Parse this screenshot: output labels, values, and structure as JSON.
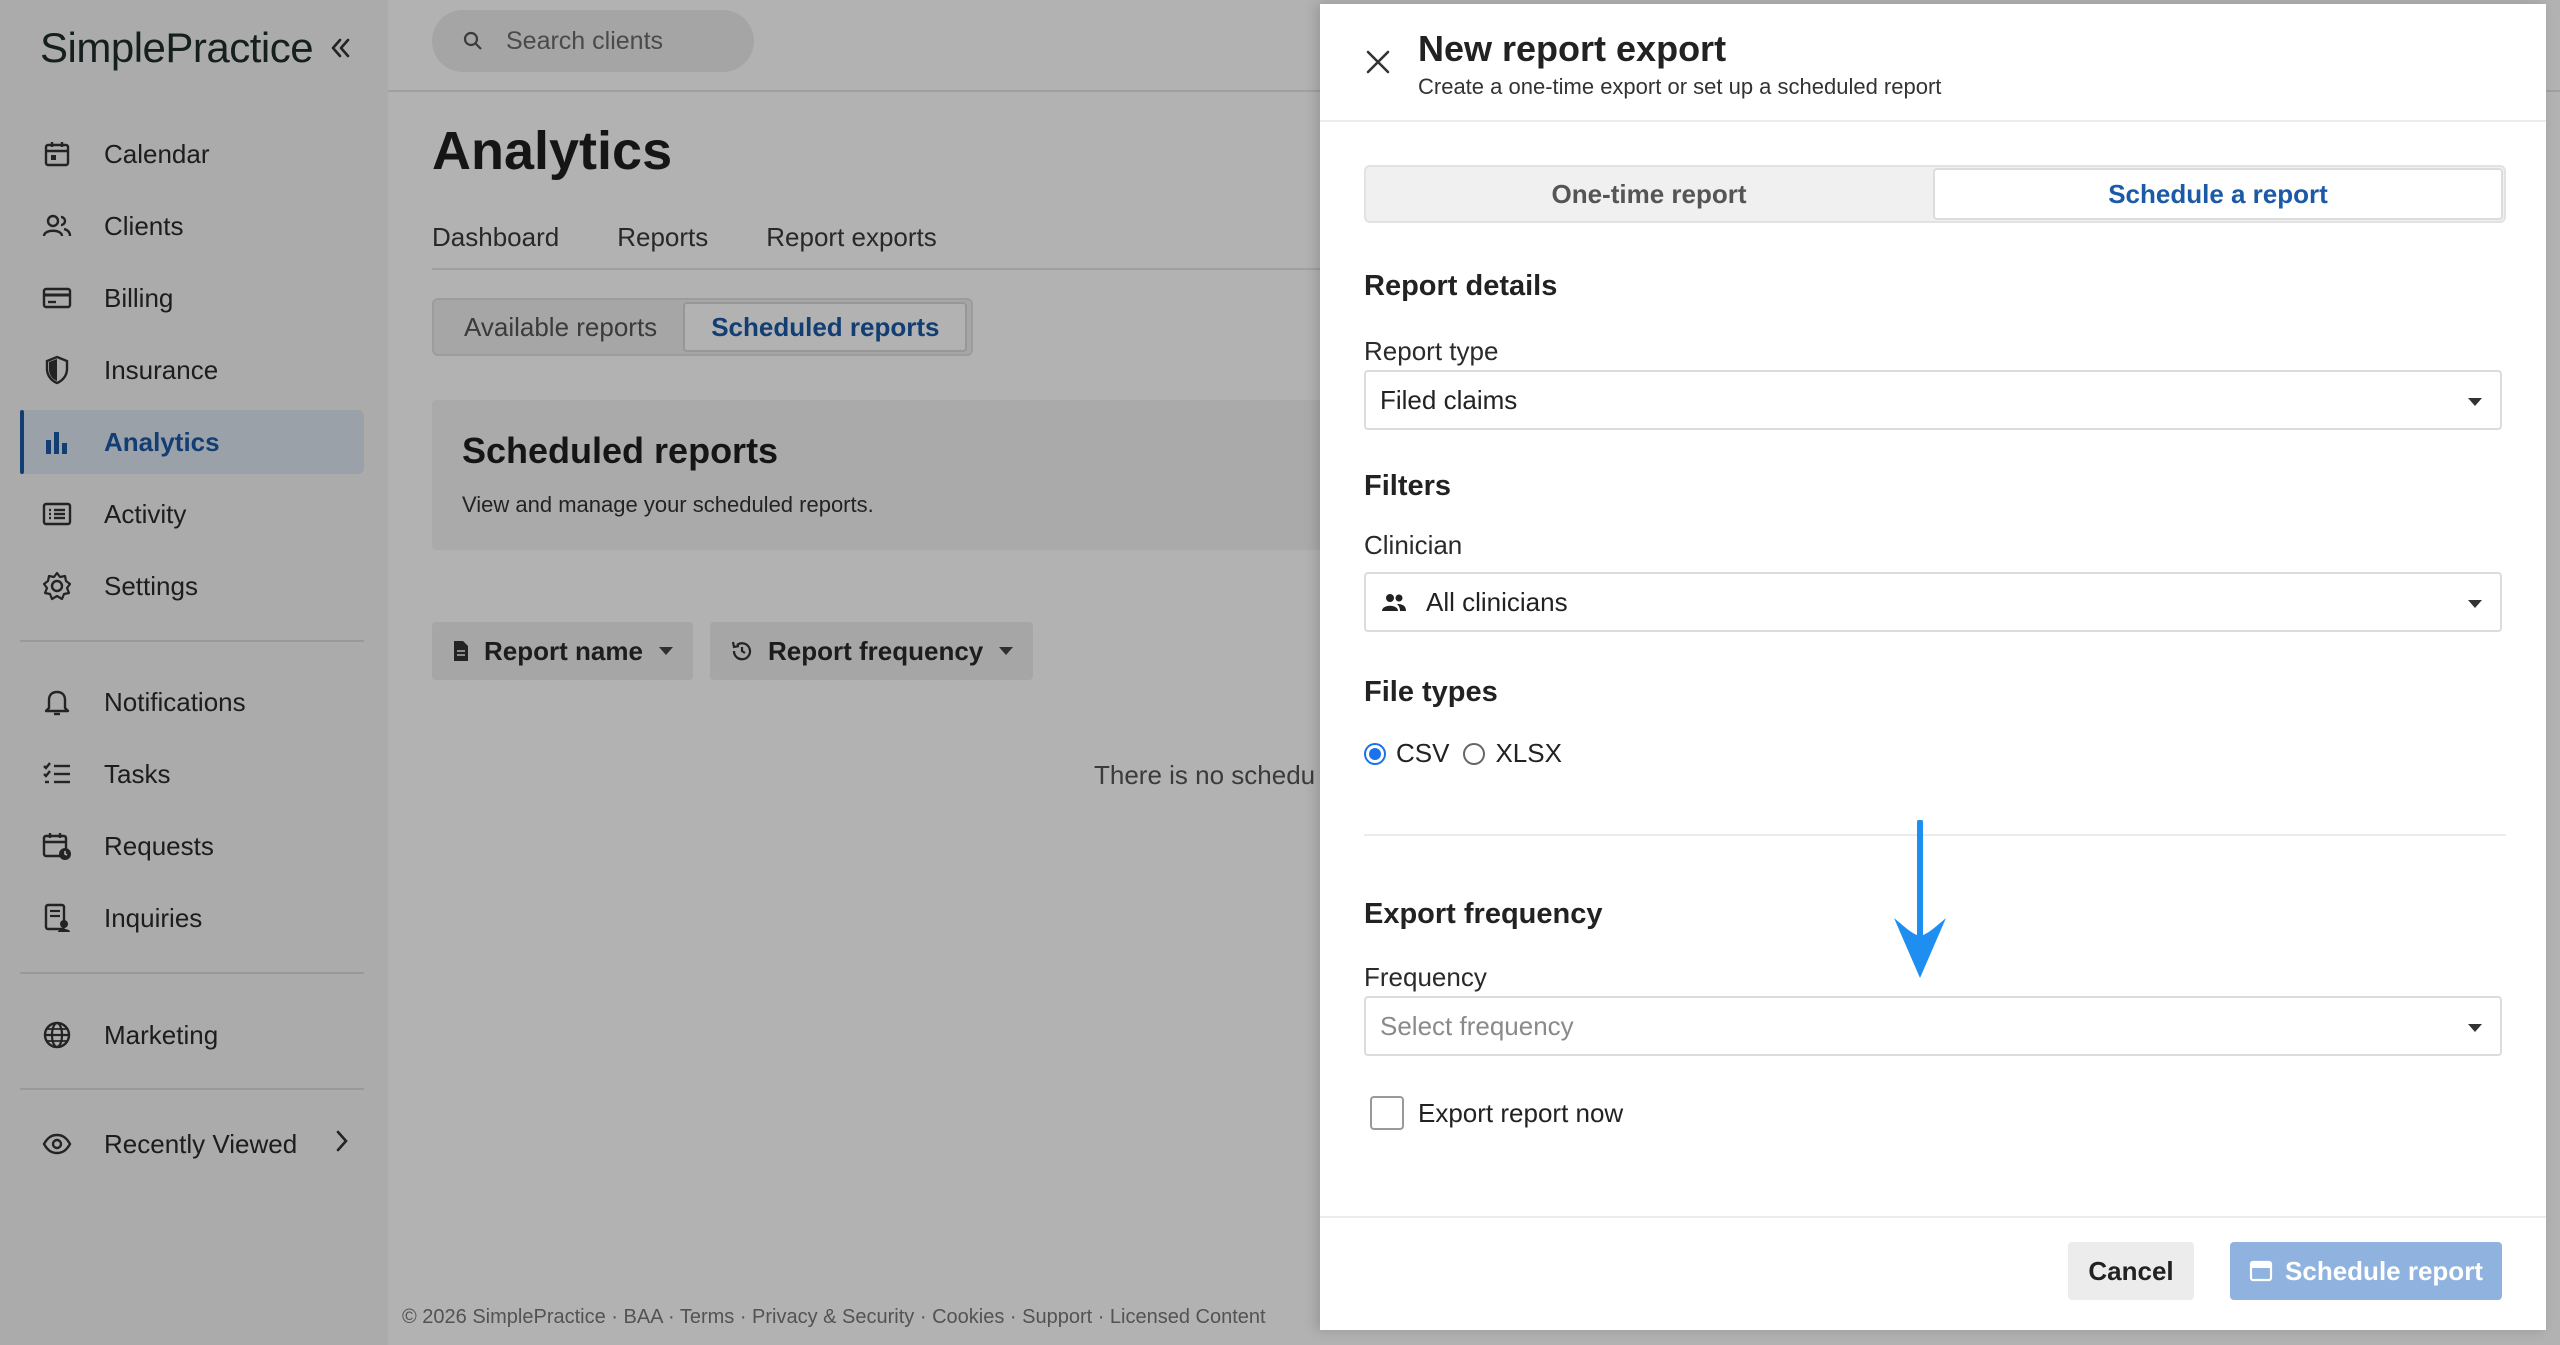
{
  "app": {
    "logo": "SimplePractice",
    "search_placeholder": "Search clients"
  },
  "sidebar": {
    "items": [
      {
        "label": "Calendar",
        "icon": "calendar-icon"
      },
      {
        "label": "Clients",
        "icon": "clients-icon"
      },
      {
        "label": "Billing",
        "icon": "billing-icon"
      },
      {
        "label": "Insurance",
        "icon": "shield-icon"
      },
      {
        "label": "Analytics",
        "icon": "bar-chart-icon",
        "active": true
      },
      {
        "label": "Activity",
        "icon": "activity-icon"
      },
      {
        "label": "Settings",
        "icon": "gear-icon"
      },
      {
        "label": "Notifications",
        "icon": "bell-icon"
      },
      {
        "label": "Tasks",
        "icon": "tasks-icon"
      },
      {
        "label": "Requests",
        "icon": "requests-icon"
      },
      {
        "label": "Inquiries",
        "icon": "inquiries-icon"
      },
      {
        "label": "Marketing",
        "icon": "globe-icon"
      },
      {
        "label": "Recently Viewed",
        "icon": "eye-icon"
      }
    ]
  },
  "main": {
    "title": "Analytics",
    "tabs": [
      "Dashboard",
      "Reports",
      "Report exports"
    ],
    "segments": [
      "Available reports",
      "Scheduled reports"
    ],
    "scheduled_box": {
      "title": "Scheduled reports",
      "description": "View and manage your scheduled reports."
    },
    "filters": {
      "report_name": "Report name",
      "report_frequency": "Report frequency"
    },
    "empty_text": "There is no schedu",
    "footer": "© 2026 SimplePractice · BAA · Terms · Privacy & Security · Cookies · Support · Licensed Content"
  },
  "drawer": {
    "title": "New report export",
    "subtitle": "Create a one-time export or set up a scheduled report",
    "mode_tabs": [
      "One-time report",
      "Schedule a report"
    ],
    "report_details": {
      "section_title": "Report details",
      "report_type_label": "Report type",
      "report_type_value": "Filed claims"
    },
    "filters": {
      "section_title": "Filters",
      "clinician_label": "Clinician",
      "clinician_value": "All clinicians"
    },
    "file_types": {
      "section_title": "File types",
      "options": [
        "CSV",
        "XLSX"
      ],
      "selected": "CSV"
    },
    "export_frequency": {
      "section_title": "Export frequency",
      "frequency_label": "Frequency",
      "frequency_placeholder": "Select frequency",
      "export_now_label": "Export report now"
    },
    "buttons": {
      "cancel": "Cancel",
      "schedule": "Schedule report"
    },
    "colors": {
      "accent": "#1a5aa6",
      "annotation_arrow": "#1e8ff0",
      "disabled_primary": "#8fb3de"
    }
  }
}
